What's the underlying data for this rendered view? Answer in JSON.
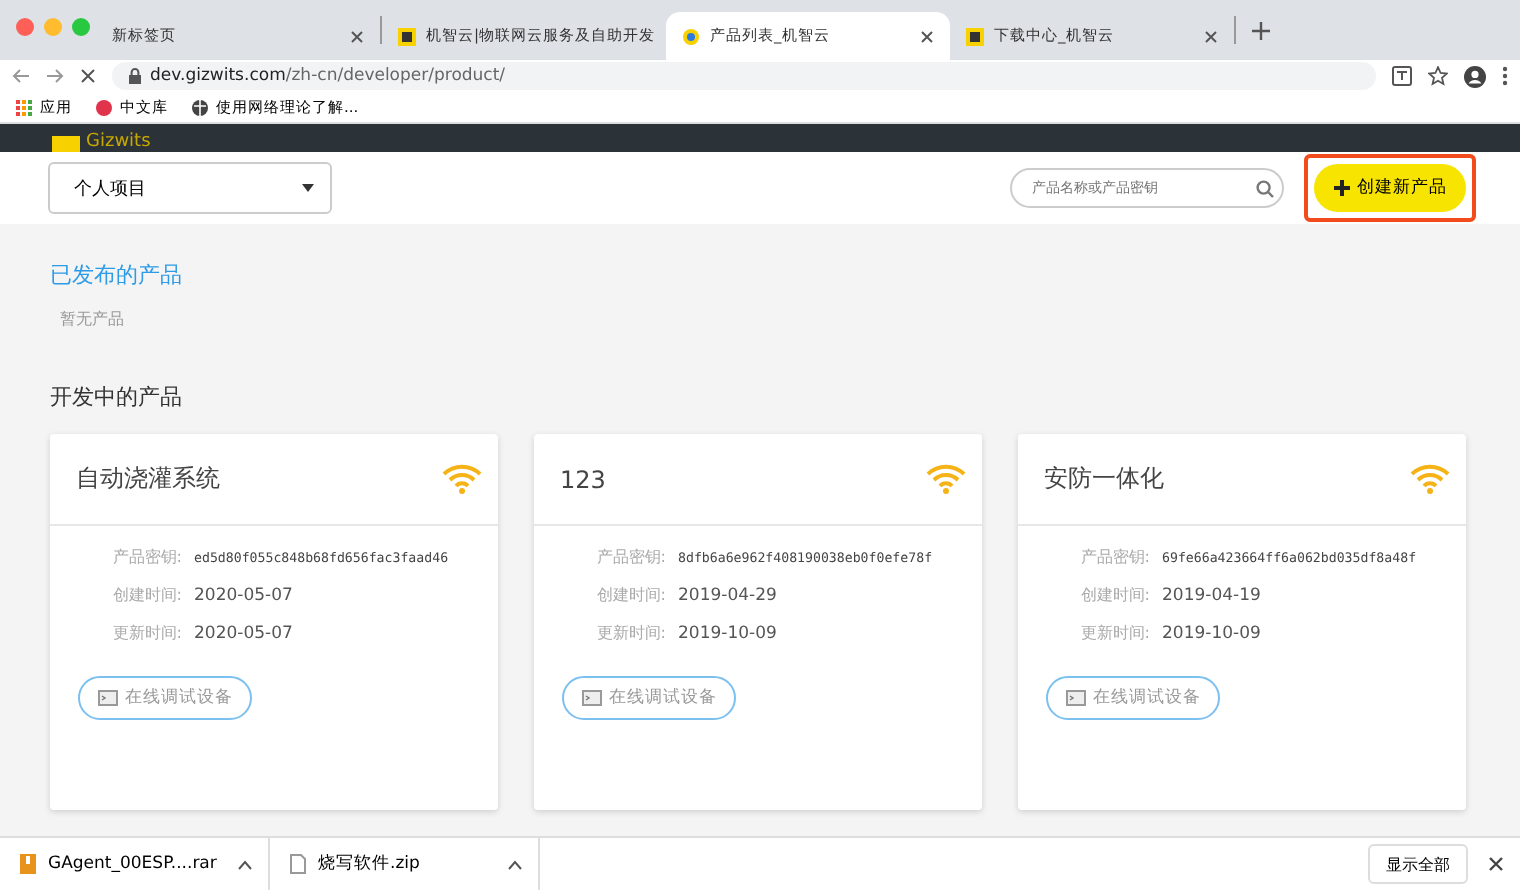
{
  "browser": {
    "tabs": [
      {
        "title": "新标签页",
        "selected": false
      },
      {
        "title": "机智云|物联网云服务及自助开发",
        "selected": false
      },
      {
        "title": "产品列表_机智云",
        "selected": true
      },
      {
        "title": "下载中心_机智云",
        "selected": false
      }
    ],
    "url_host": "dev.gizwits.com",
    "url_path": "/zh-cn/developer/product/",
    "bookmarks": [
      {
        "label": "应用"
      },
      {
        "label": "中文库"
      },
      {
        "label": "使用网络理论了解..."
      }
    ]
  },
  "header": {
    "logo_text": "Gizwits"
  },
  "toolbar": {
    "project": "个人项目",
    "search_placeholder": "产品名称或产品密钥",
    "create_button": "创建新产品"
  },
  "published": {
    "title": "已发布的产品",
    "empty_text": "暂无产品"
  },
  "developing": {
    "title": "开发中的产品",
    "cards": [
      {
        "name": "自动浇灌系统",
        "key_label": "产品密钥:",
        "key": "ed5d80f055c848b68fd656fac3faad46",
        "created_label": "创建时间:",
        "created": "2020-05-07",
        "updated_label": "更新时间:",
        "updated": "2020-05-07",
        "button": "在线调试设备"
      },
      {
        "name": "123",
        "key_label": "产品密钥:",
        "key": "8dfb6a6e962f408190038eb0f0efe78f",
        "created_label": "创建时间:",
        "created": "2019-04-29",
        "updated_label": "更新时间:",
        "updated": "2019-10-09",
        "button": "在线调试设备"
      },
      {
        "name": "安防一体化",
        "key_label": "产品密钥:",
        "key": "69fe66a423664ff6a062bd035df8a48f",
        "created_label": "创建时间:",
        "created": "2019-04-19",
        "updated_label": "更新时间:",
        "updated": "2019-10-09",
        "button": "在线调试设备"
      }
    ]
  },
  "downloads": {
    "items": [
      {
        "name": "GAgent_00ESP....rar",
        "kind": "archive"
      },
      {
        "name": "烧写软件.zip",
        "kind": "file"
      }
    ],
    "show_all": "显示全部"
  }
}
